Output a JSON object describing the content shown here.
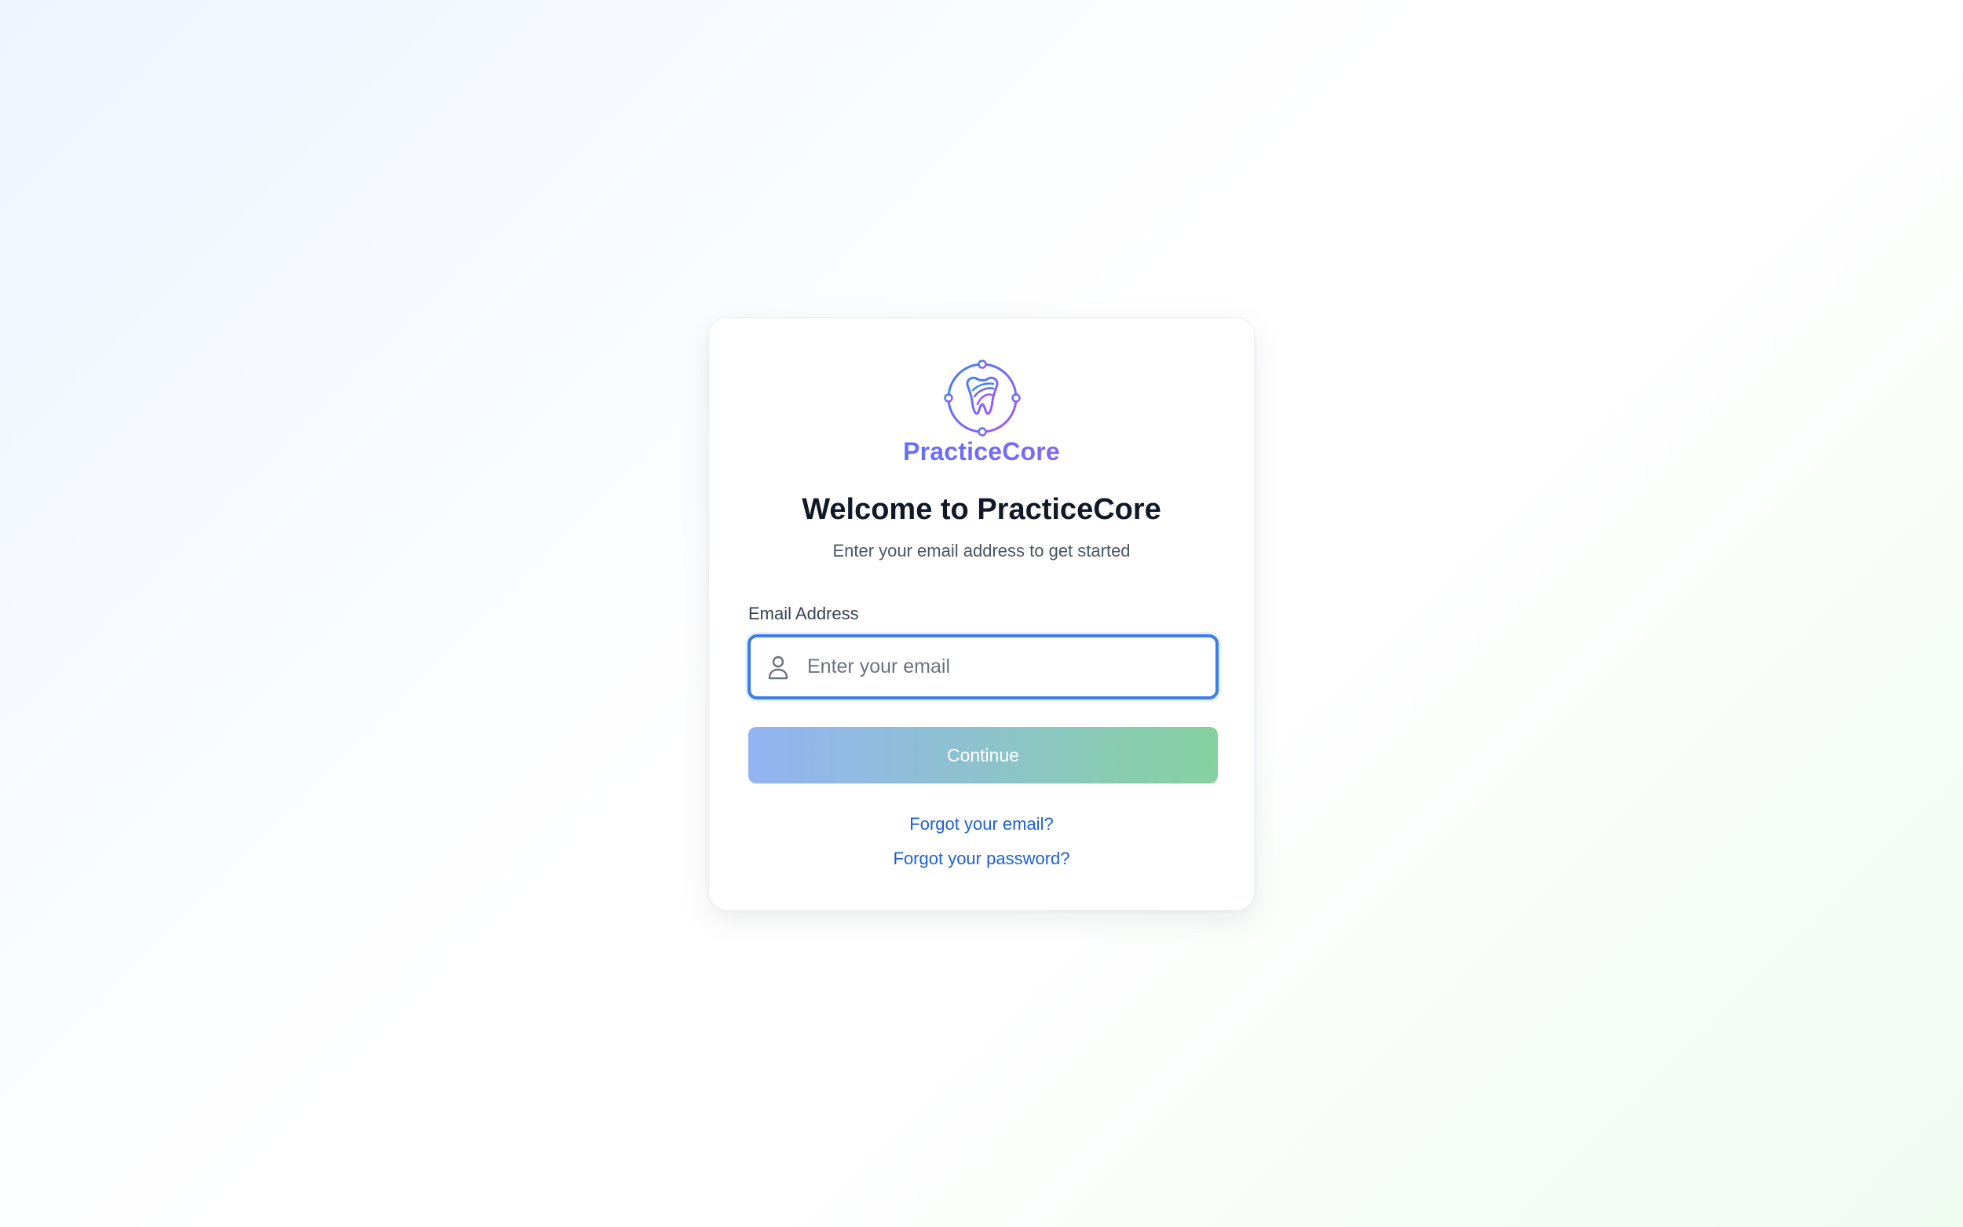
{
  "brand": {
    "name": "PracticeCore",
    "logo_icon": "tooth-icon",
    "gradient_start": "#3b82f6",
    "gradient_end": "#a855f7"
  },
  "login": {
    "title": "Welcome to PracticeCore",
    "subtitle": "Enter your email address to get started",
    "email_label": "Email Address",
    "email_value": "",
    "email_placeholder": "Enter your email",
    "email_icon": "user-icon",
    "continue_label": "Continue",
    "forgot_email_link": "Forgot your email?",
    "forgot_password_link": "Forgot your password?"
  },
  "colors": {
    "input_focus_border": "#3b7de9",
    "link": "#1d5fd6",
    "button_gradient_start": "#93b3f3",
    "button_gradient_end": "#86d19f"
  }
}
